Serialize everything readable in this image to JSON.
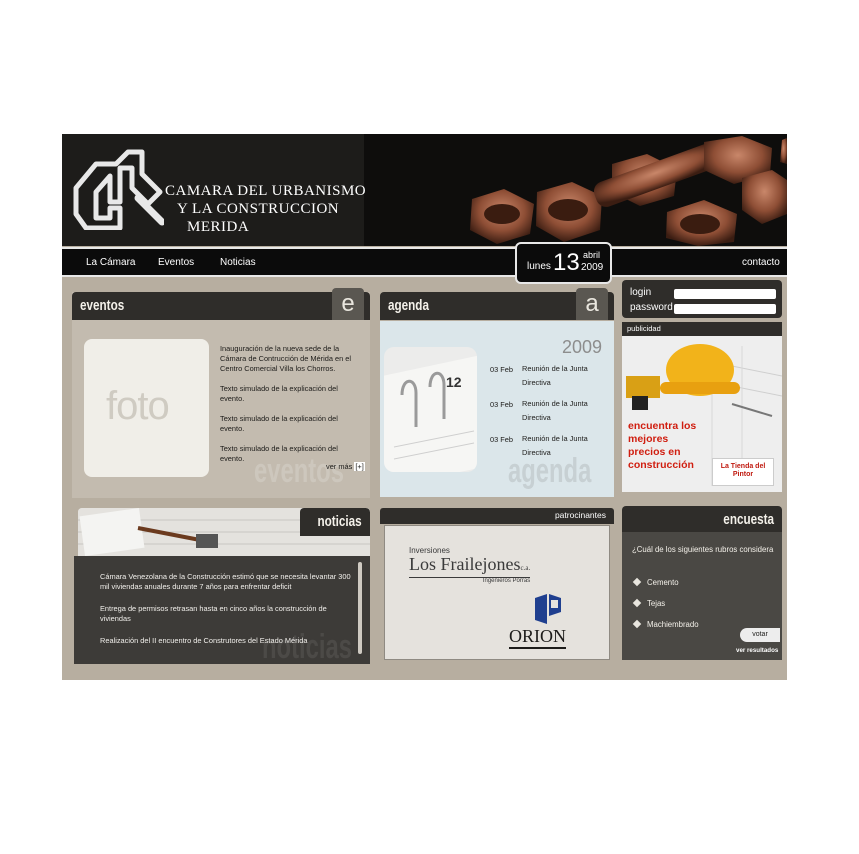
{
  "header": {
    "logo_line1": "CAMARA DEL URBANISMO",
    "logo_line2": "Y  LA CONSTRUCCION",
    "logo_line3": "MERIDA"
  },
  "nav": {
    "items": [
      "La Cámara",
      "Eventos",
      "Noticias"
    ],
    "contact": "contacto"
  },
  "date": {
    "weekday": "lunes",
    "day": "13",
    "month": "abril",
    "year": "2009"
  },
  "eventos": {
    "title": "eventos",
    "letter": "e",
    "photo_placeholder": "foto",
    "items": [
      "Inauguración de la nueva sede de la Cámara de Contrucción de Mérida en el Centro Comercial Villa los Chorros.",
      "Texto simulado de la explicación del evento.",
      "Texto simulado de la explicación del evento.",
      "Texto simulado de la explicación del evento."
    ],
    "more": "ver más",
    "more_icon": "[+]",
    "watermark": "eventos"
  },
  "agenda": {
    "title": "agenda",
    "letter": "a",
    "year": "2009",
    "items": [
      {
        "date": "03 Feb",
        "desc": "Reunión de la Junta Directiva"
      },
      {
        "date": "03 Feb",
        "desc": "Reunión de la Junta Directiva"
      },
      {
        "date": "03 Feb",
        "desc": "Reunión de la Junta Directiva"
      }
    ],
    "watermark": "agenda"
  },
  "login": {
    "login_label": "login",
    "password_label": "password"
  },
  "publicidad": {
    "title": "publicidad",
    "ad_text": "encuentra los mejores precios en construcción",
    "brand": "La Tienda del Pintor"
  },
  "noticias": {
    "title": "noticias",
    "items": [
      "Cámara Venezolana de la Construcción estimó que se necesita levantar 300 mil viviendas anuales durante 7 años para enfrentar deficit",
      "Entrega de permisos retrasan hasta en cinco años la construcción de viviendas",
      "Realización del II encuentro de Construtores del Estado Mérida"
    ],
    "watermark": "noticias"
  },
  "patrocinantes": {
    "title": "patrocinantes",
    "sponsor1_top": "Inversiones",
    "sponsor1_name": "Los Frailejones",
    "sponsor1_suffix": "c.a.",
    "sponsor1_sub": "Ingenieros Porras",
    "sponsor2_name": "ORION"
  },
  "encuesta": {
    "title": "encuesta",
    "question": "¿Cuál de los siguientes rubros considera",
    "options": [
      "Cemento",
      "Tejas",
      "Machiembrado"
    ],
    "vote": "votar",
    "results": "ver resultados"
  }
}
